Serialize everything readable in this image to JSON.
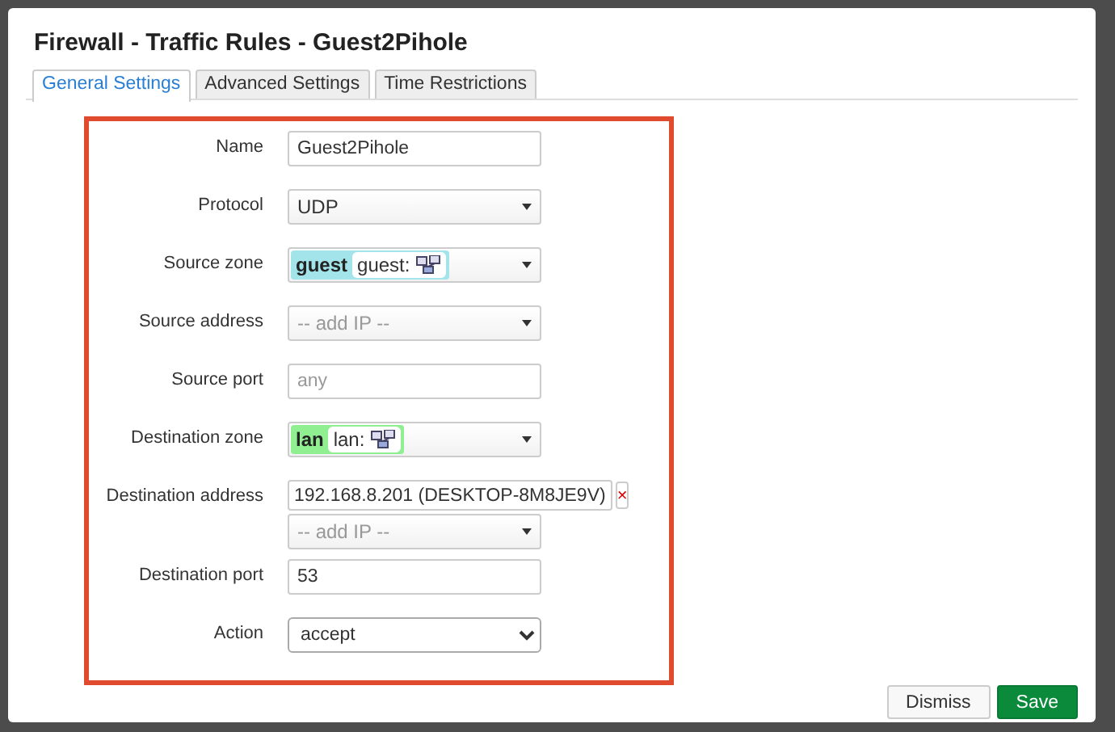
{
  "dialog": {
    "title": "Firewall - Traffic Rules - Guest2Pihole"
  },
  "tabs": [
    {
      "label": "General Settings",
      "selected": true
    },
    {
      "label": "Advanced Settings",
      "selected": false
    },
    {
      "label": "Time Restrictions",
      "selected": false
    }
  ],
  "fields": [
    {
      "kind": "text",
      "label": "Name",
      "value": "Guest2Pihole"
    },
    {
      "kind": "select",
      "label": "Protocol",
      "value": "UDP"
    },
    {
      "kind": "zone",
      "label": "Source zone",
      "zone": "guest",
      "zone_label": "guest:",
      "color": "#a2e4ea"
    },
    {
      "kind": "select",
      "label": "Source address",
      "placeholder": "-- add IP --"
    },
    {
      "kind": "text",
      "label": "Source port",
      "placeholder": "any"
    },
    {
      "kind": "zone",
      "label": "Destination zone",
      "zone": "lan",
      "zone_label": "lan:",
      "color": "#90ef90"
    },
    {
      "kind": "address",
      "label": "Destination address",
      "entry": "192.168.8.201 (DESKTOP-8M8JE9V)",
      "remove": "×",
      "placeholder": "-- add IP --"
    },
    {
      "kind": "text",
      "label": "Destination port",
      "value": "53"
    },
    {
      "kind": "native",
      "label": "Action",
      "value": "accept"
    }
  ],
  "buttons": [
    {
      "label": "Dismiss",
      "kind": "neutral"
    },
    {
      "label": "Save",
      "kind": "primary"
    }
  ]
}
